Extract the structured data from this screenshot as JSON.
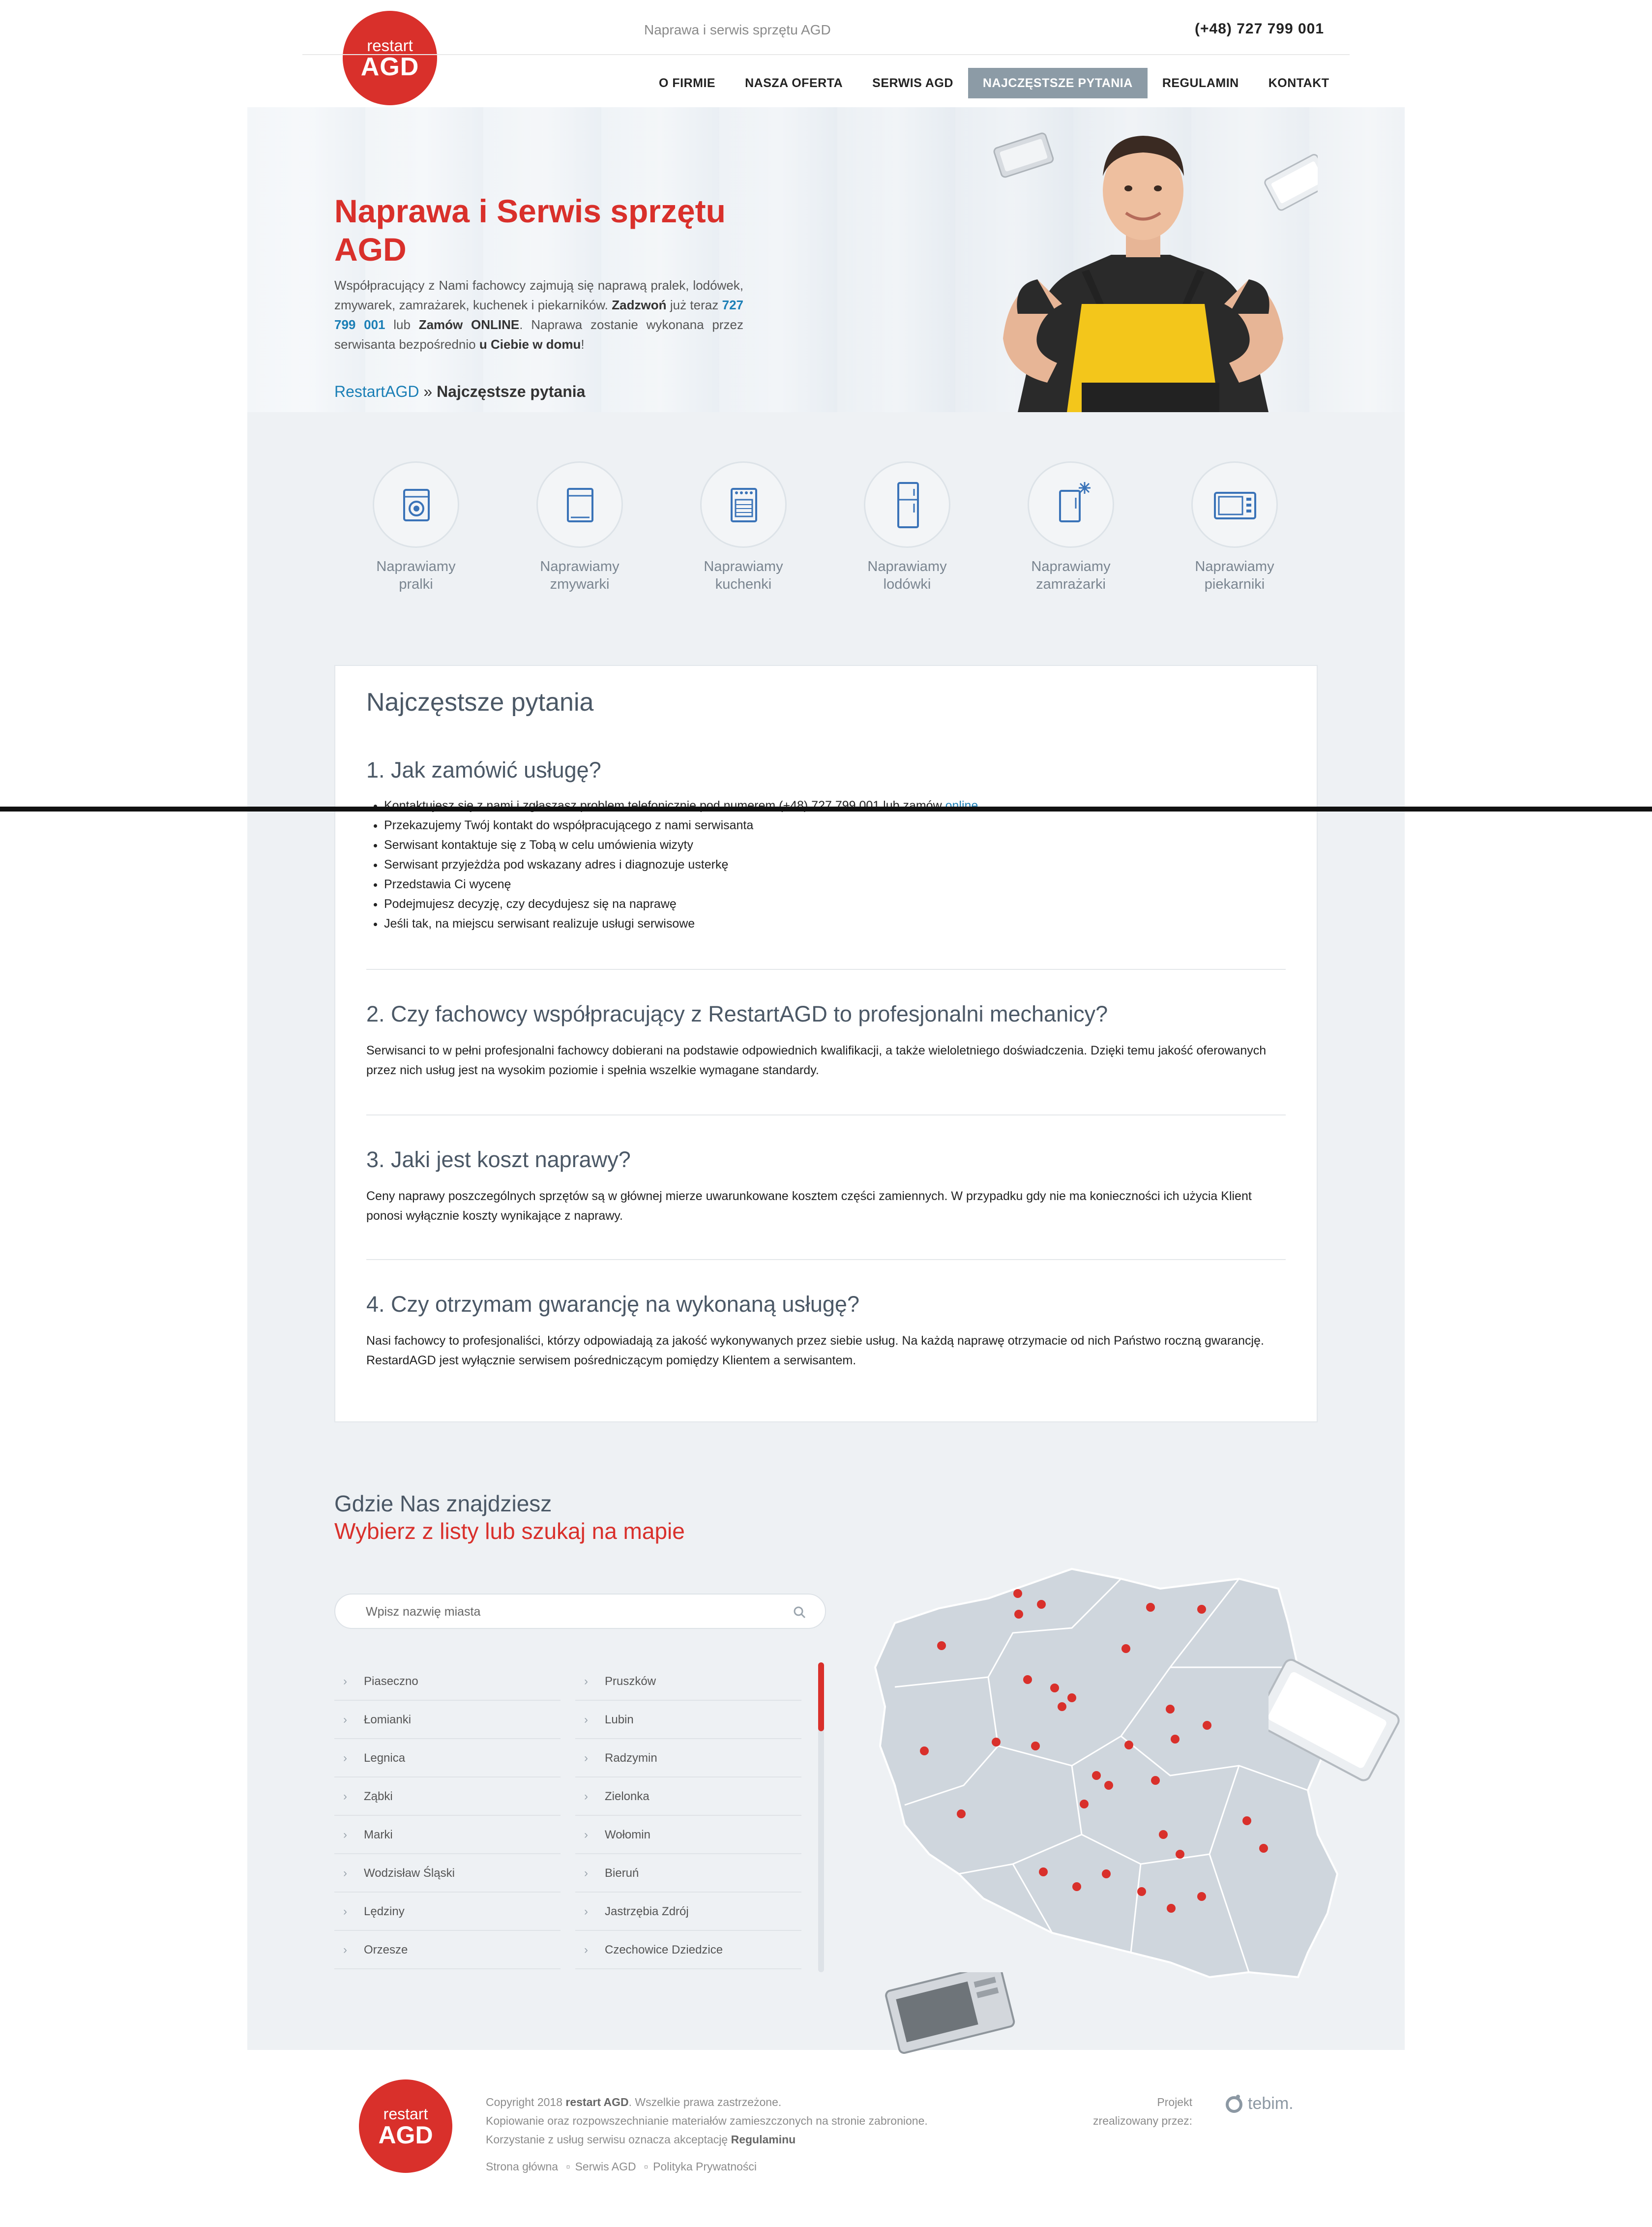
{
  "header": {
    "logo_top": "restart",
    "logo_bottom": "AGD",
    "tagline": "Naprawa i serwis sprzętu AGD",
    "phone": "(+48) 727 799 001",
    "nav": [
      "O FIRMIE",
      "NASZA OFERTA",
      "SERWIS AGD",
      "NAJCZĘSTSZE PYTANIA",
      "REGULAMIN",
      "KONTAKT"
    ],
    "nav_active": "NAJCZĘSTSZE PYTANIA"
  },
  "hero": {
    "title_line1": "Naprawa i Serwis sprzętu",
    "title_line2": "AGD",
    "text_a": "Współpracujący z Nami fachowcy zajmują się naprawą pralek, lodówek, zmywarek, zamrażarek, kuchenek i piekarników. ",
    "text_b": "Zadzwoń",
    "text_c": " już teraz ",
    "text_phone": "727 799 001",
    "text_d": " lub ",
    "text_e": "Zamów ONLINE",
    "text_f": ". Naprawa zostanie wykonana przez serwisanta bezpośrednio ",
    "text_g": "u Ciebie w domu",
    "text_h": "!"
  },
  "breadcrumb": {
    "home": "RestartAGD",
    "sep": " » ",
    "current": "Najczęstsze pytania"
  },
  "services": [
    {
      "line1": "Naprawiamy",
      "line2": "pralki",
      "icon": "washing-machine-icon"
    },
    {
      "line1": "Naprawiamy",
      "line2": "zmywarki",
      "icon": "dishwasher-icon"
    },
    {
      "line1": "Naprawiamy",
      "line2": "kuchenki",
      "icon": "stove-icon"
    },
    {
      "line1": "Naprawiamy",
      "line2": "lodówki",
      "icon": "fridge-icon"
    },
    {
      "line1": "Naprawiamy",
      "line2": "zamrażarki",
      "icon": "freezer-icon"
    },
    {
      "line1": "Naprawiamy",
      "line2": "piekarniki",
      "icon": "oven-icon"
    }
  ],
  "faq": {
    "title": "Najczęstsze pytania",
    "q1": "1. Jak zamówić usługę?",
    "q1_steps": [
      "Kontaktujesz się z nami i zgłaszasz problem telefonicznie pod numerem (+48) 727 799 001 lub zamów ",
      "Przekazujemy Twój kontakt do współpracującego z nami serwisanta",
      "Serwisant kontaktuje się z Tobą w celu umówienia wizyty",
      "Serwisant przyjeżdża pod wskazany adres i diagnozuje usterkę",
      "Przedstawia Ci wycenę",
      "Podejmujesz decyzję, czy decydujesz się na naprawę",
      "Jeśli tak, na miejscu serwisant realizuje usługi serwisowe"
    ],
    "q1_online_link": "online",
    "q2": "2. Czy fachowcy współpracujący z RestartAGD to profesjonalni mechanicy?",
    "a2": "Serwisanci to w pełni profesjonalni fachowcy dobierani na podstawie odpowiednich kwalifikacji, a także wieloletniego doświadczenia. Dzięki temu jakość oferowanych przez nich usług jest na wysokim poziomie i spełnia wszelkie wymagane standardy.",
    "q3": "3. Jaki jest koszt naprawy?",
    "a3": "Ceny naprawy poszczególnych sprzętów są w głównej mierze uwarunkowane kosztem części zamiennych. W przypadku gdy nie ma konieczności ich użycia Klient ponosi wyłącznie koszty wynikające z naprawy.",
    "q4": "4. Czy otrzymam gwarancję na wykonaną usługę?",
    "a4": "Nasi fachowcy to profesjonaliści, którzy odpowiadają za jakość wykonywanych przez siebie usług. Na każdą naprawę otrzymacie od nich Państwo roczną gwarancję. RestardAGD jest wyłącznie serwisem pośredniczącym pomiędzy Klientem a serwisantem."
  },
  "map": {
    "title": "Gdzie Nas znajdziesz",
    "subtitle": "Wybierz z listy lub szukaj na mapie",
    "search_placeholder": "Wpisz nazwię miasta",
    "cities_left": [
      "Piaseczno",
      "Łomianki",
      "Legnica",
      "Ząbki",
      "Marki",
      "Wodzisław Śląski",
      "Lędziny",
      "Orzesze"
    ],
    "cities_right": [
      "Pruszków",
      "Lubin",
      "Radzymin",
      "Zielonka",
      "Wołomin",
      "Bieruń",
      "Jastrzębia Zdrój",
      "Czechowice Dziedzice"
    ],
    "accent_color": "#d9302b"
  },
  "footer": {
    "copy_a": "Copyright 2018 ",
    "copy_b": "restart AGD",
    "copy_c": ". Wszelkie prawa zastrzeżone.",
    "line2": "Kopiowanie oraz rozpowszechnianie materiałów zamieszczonych na stronie zabronione.",
    "line3_a": "Korzystanie z usług serwisu oznacza akceptację ",
    "line3_b": "Regulaminu",
    "links": [
      "Strona główna",
      "Serwis AGD",
      "Polityka Prywatności"
    ],
    "project_line1": "Projekt",
    "project_line2": "zrealizowany przez:",
    "tebim": "tebim."
  }
}
